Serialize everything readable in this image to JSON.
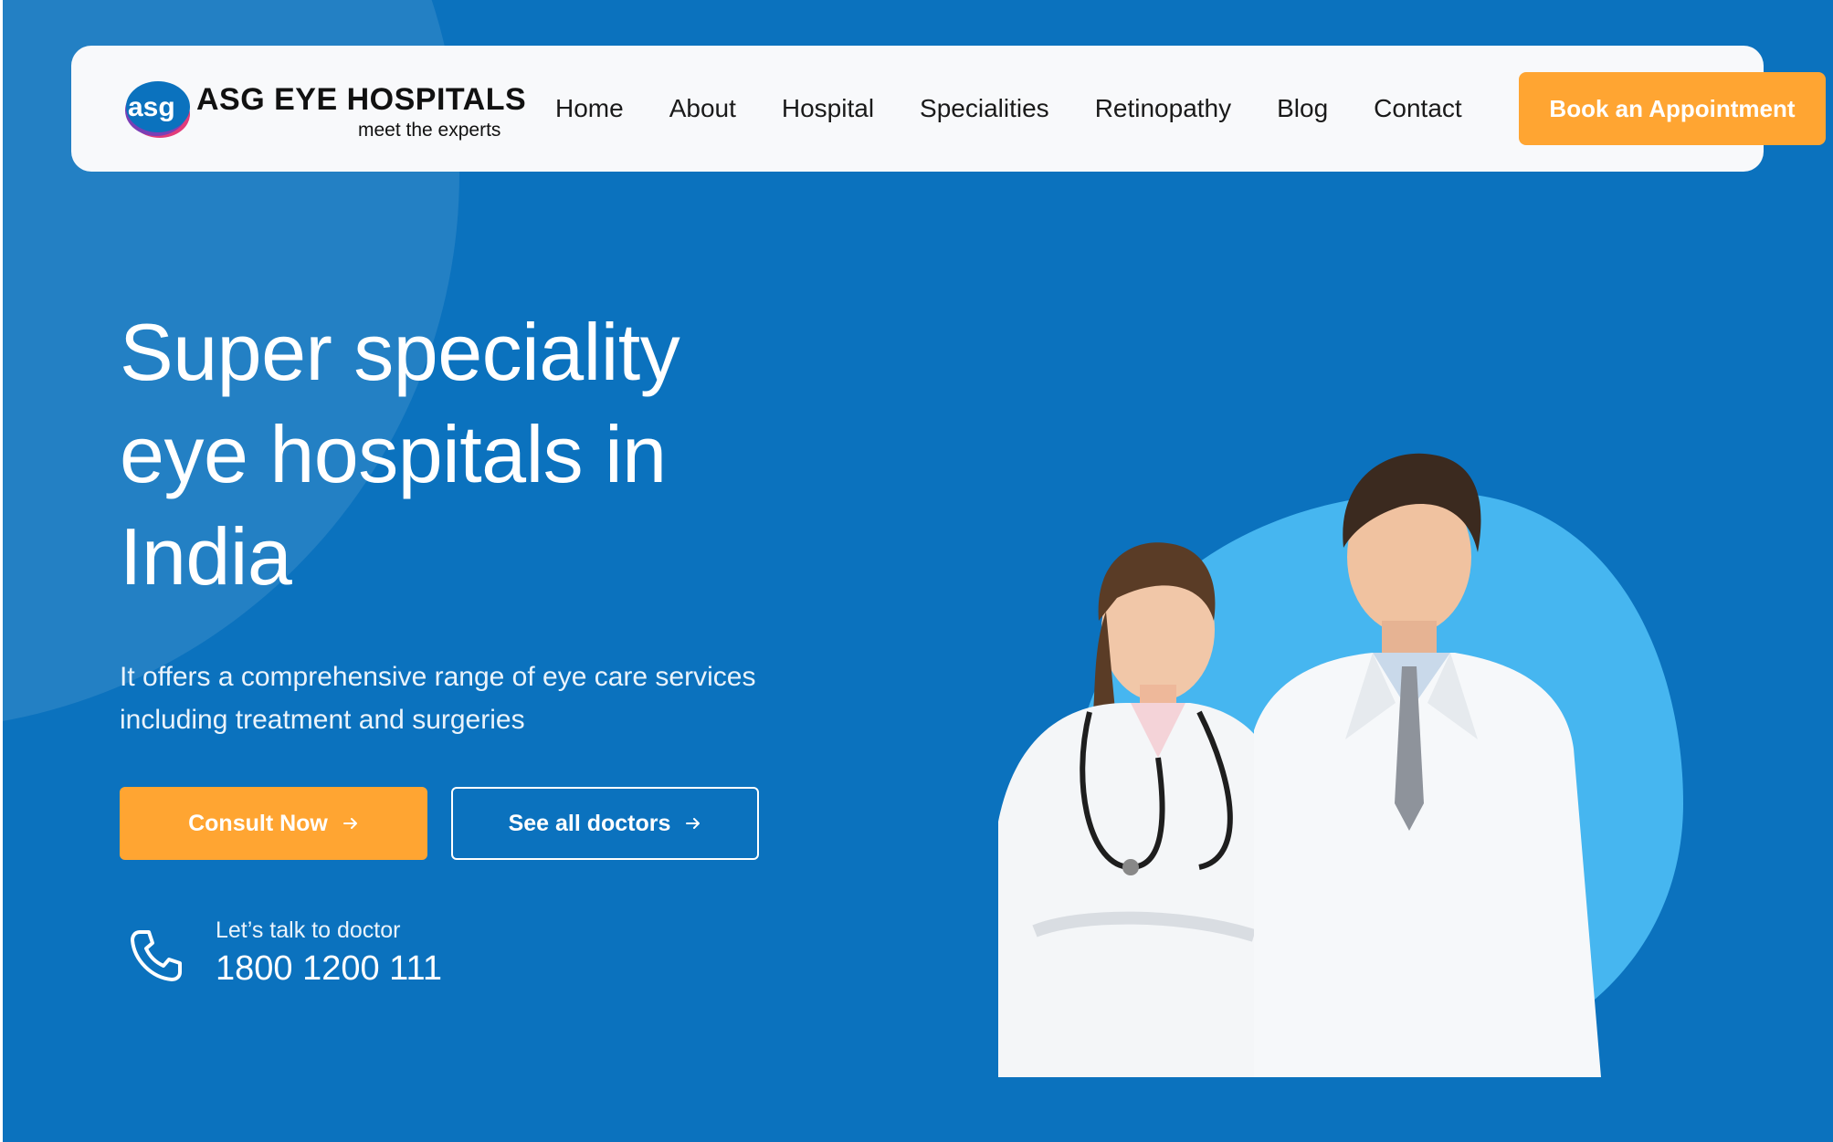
{
  "brand": {
    "logo_mark": "asg",
    "name": "ASG EYE HOSPITALS",
    "tagline": "meet the experts"
  },
  "nav": {
    "items": [
      {
        "label": "Home"
      },
      {
        "label": "About"
      },
      {
        "label": "Hospital"
      },
      {
        "label": "Specialities"
      },
      {
        "label": "Retinopathy"
      },
      {
        "label": "Blog"
      },
      {
        "label": "Contact"
      }
    ],
    "cta_label": "Book an Appointment"
  },
  "hero": {
    "headline_lines": [
      "Super speciality",
      "eye hospitals in",
      "India"
    ],
    "subtext_lines": [
      "It offers a comprehensive range of eye care services",
      "including treatment and surgeries"
    ],
    "primary_button": "Consult Now",
    "secondary_button": "See all doctors",
    "phone_label": "Let’s talk to doctor",
    "phone_number": "1800 1200 111",
    "illustration_icon": "doctors-illustration"
  },
  "colors": {
    "hero_background": "#0b72be",
    "accent_orange": "#ffa532",
    "circle_light_blue": "#46b6f0",
    "nav_background": "#f8f9fb"
  }
}
